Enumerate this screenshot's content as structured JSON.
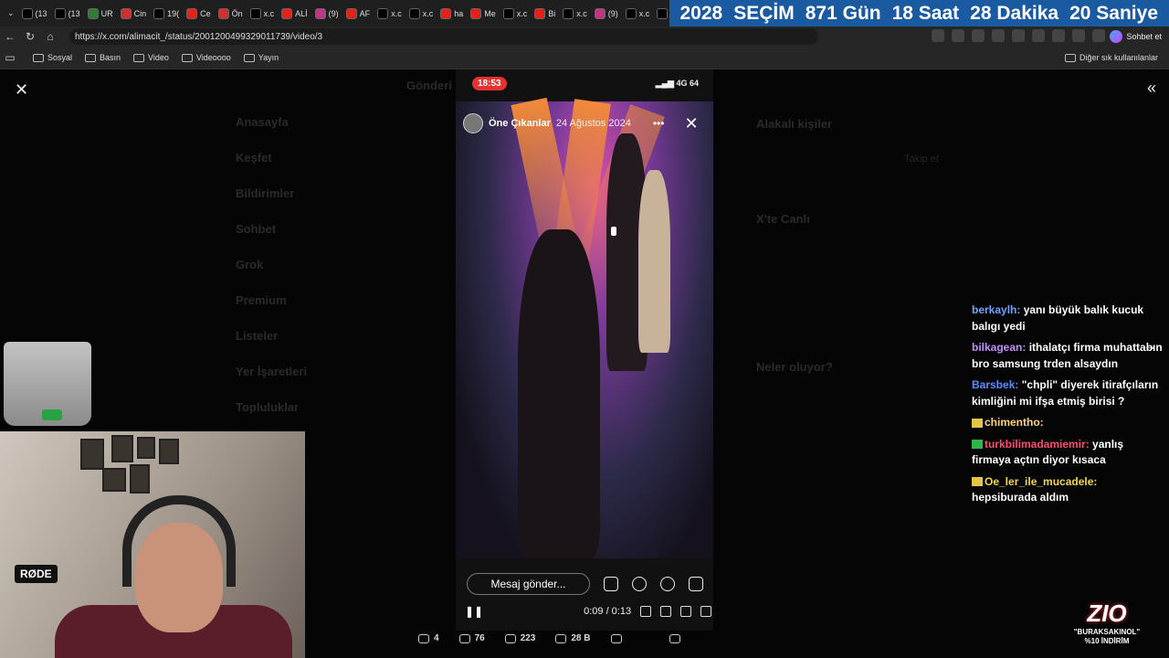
{
  "tabs": [
    {
      "label": "(13",
      "icon": "x-icon",
      "color": "#000000"
    },
    {
      "label": "(13",
      "icon": "x-icon",
      "color": "#000000"
    },
    {
      "label": "UR",
      "icon": "site-icon",
      "color": "#2e7d32"
    },
    {
      "label": "Cin",
      "icon": "site-icon",
      "color": "#d32f2f"
    },
    {
      "label": "19(",
      "icon": "site-icon",
      "color": "#000000"
    },
    {
      "label": "Ce",
      "icon": "youtube-icon",
      "color": "#e62117"
    },
    {
      "label": "Ön",
      "icon": "site-icon",
      "color": "#d32f2f"
    },
    {
      "label": "x.c",
      "icon": "x-icon",
      "color": "#000000"
    },
    {
      "label": "ALİ",
      "icon": "youtube-icon",
      "color": "#e62117"
    },
    {
      "label": "(9)",
      "icon": "instagram-icon",
      "color": "#c13584"
    },
    {
      "label": "AF",
      "icon": "youtube-icon",
      "color": "#e62117"
    },
    {
      "label": "x.c",
      "icon": "x-icon",
      "color": "#000000"
    },
    {
      "label": "x.c",
      "icon": "x-icon",
      "color": "#000000"
    },
    {
      "label": "ha",
      "icon": "youtube-icon",
      "color": "#e62117"
    },
    {
      "label": "Me",
      "icon": "youtube-icon",
      "color": "#e62117"
    },
    {
      "label": "x.c",
      "icon": "x-icon",
      "color": "#000000"
    },
    {
      "label": "Bi",
      "icon": "youtube-icon",
      "color": "#e62117"
    },
    {
      "label": "x.c",
      "icon": "x-icon",
      "color": "#000000"
    },
    {
      "label": "(9)",
      "icon": "instagram-icon",
      "color": "#c13584"
    },
    {
      "label": "x.c",
      "icon": "x-icon",
      "color": "#000000"
    },
    {
      "label": "x.c",
      "icon": "x-icon",
      "color": "#000000"
    }
  ],
  "countdown": {
    "year": "2028",
    "label": "SEÇİM",
    "days": "871 Gün",
    "hours": "18 Saat",
    "minutes": "28 Dakika",
    "seconds": "20 Saniye",
    "color": "#1a5aa0"
  },
  "address": {
    "url": "https://x.com/alimacit_/status/2001200499329011739/video/3",
    "chat_label": "Sohbet et"
  },
  "bookmarks": {
    "items": [
      "Sosyal",
      "Basın",
      "Video",
      "Videoooo",
      "Yayın"
    ],
    "other": "Diğer sık kullanılanlar"
  },
  "background_page": {
    "nav": [
      "Anasayfa",
      "Keşfet",
      "Bildirimler",
      "Sohbet",
      "Grok",
      "Premium",
      "Listeler",
      "Yer İşaretleri",
      "Topluluklar"
    ],
    "post_header": "Gönderi",
    "right_titles": [
      "Alakalı kişiler",
      "X'te Canlı",
      "Neler oluyor?"
    ],
    "follow_label": "Takip et"
  },
  "story": {
    "phone_time": "18:53",
    "network": "4G",
    "battery": "64",
    "name": "Öne Çıkanlar",
    "date": "24 Ağustos 2024",
    "message_placeholder": "Mesaj gönder...",
    "time_display": "0:09 / 0:13"
  },
  "stats": {
    "replies": "4",
    "reposts": "76",
    "likes": "223",
    "views": "28 B"
  },
  "chat": [
    {
      "user": "berkaylh",
      "color": "#6ea2ff",
      "text": "yanı büyük balık kucuk balıgı yedi",
      "badge": ""
    },
    {
      "user": "bilkagean",
      "color": "#c58cff",
      "text": "ithalatçı firma muhattabın bro samsung trden alsaydın",
      "badge": ""
    },
    {
      "user": "Barsbek",
      "color": "#5b8cff",
      "text": "\"chpli\" diyerek itirafçıların kimliğini mi ifşa etmiş birisi ?",
      "badge": ""
    },
    {
      "user": "chimentho",
      "color": "#ffd37a",
      "text": "",
      "badge": "yellow"
    },
    {
      "user": "turkbilimadamiemir",
      "color": "#ff4b6e",
      "text": "yanlış firmaya açtın diyor kısaca",
      "badge": "green"
    },
    {
      "user": "Oe_ler_ile_mucadele",
      "color": "#f3d64a",
      "text": "hepsiburada aldım",
      "badge": "yellow"
    }
  ],
  "sponsor": {
    "logo": "ZIO",
    "code": "\"BURAKSAKINOL\"",
    "discount": "%10 İNDİRİM"
  },
  "webcam": {
    "mic_brand": "RØDE"
  }
}
